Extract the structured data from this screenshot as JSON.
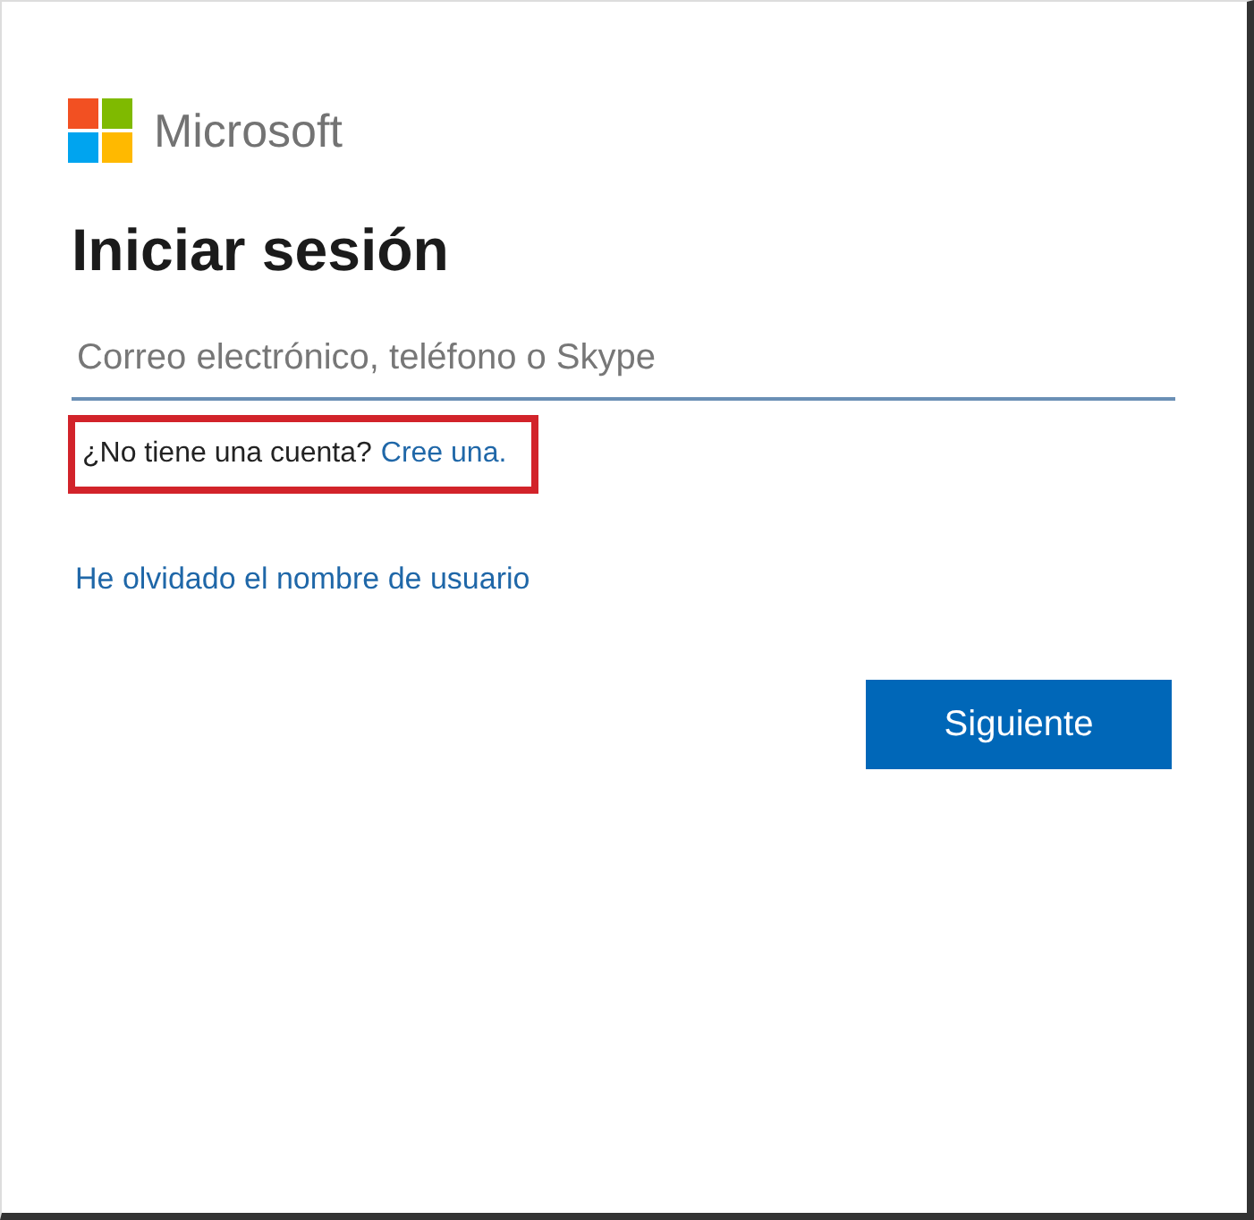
{
  "logo": {
    "text": "Microsoft"
  },
  "title": "Iniciar sesión",
  "email_field": {
    "placeholder": "Correo electrónico, teléfono o Skype"
  },
  "signup": {
    "prompt": "¿No tiene una cuenta?",
    "link": "Cree una.",
    "highlighted": true
  },
  "forgot_link": "He olvidado el nombre de usuario",
  "buttons": [
    "Siguiente"
  ]
}
